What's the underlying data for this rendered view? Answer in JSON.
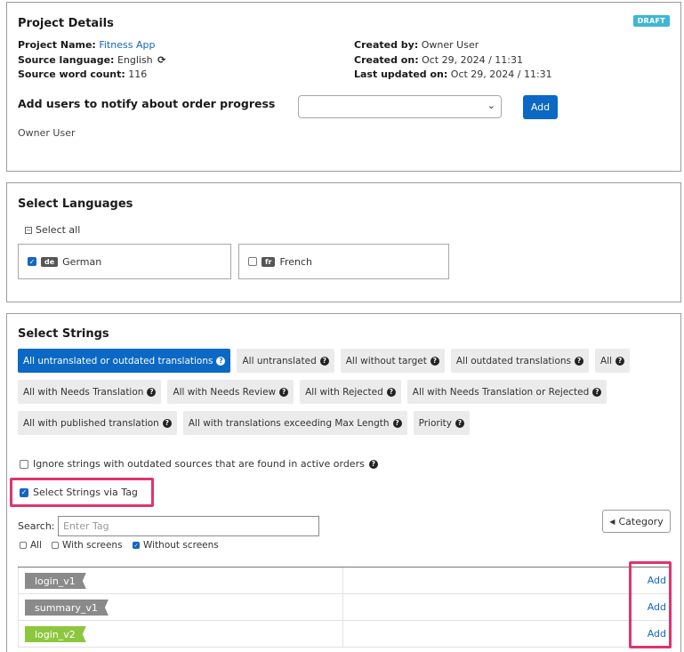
{
  "project": {
    "title": "Project Details",
    "badge": "DRAFT",
    "name_label": "Project Name:",
    "name_value": "Fitness App",
    "source_lang_label": "Source language:",
    "source_lang_value": "English",
    "word_count_label": "Source word count:",
    "word_count_value": "116",
    "created_by_label": "Created by:",
    "created_by_value": "Owner User",
    "created_on_label": "Created on:",
    "created_on_value": "Oct 29, 2024 / 11:31",
    "updated_label": "Last updated on:",
    "updated_value": "Oct 29, 2024 / 11:31",
    "notify_title": "Add users to notify about order progress",
    "add_label": "Add",
    "owner_user": "Owner User"
  },
  "languages": {
    "title": "Select Languages",
    "select_all": "Select all",
    "items": [
      {
        "code": "de",
        "name": "German",
        "checked": true
      },
      {
        "code": "fr",
        "name": "French",
        "checked": false
      }
    ]
  },
  "strings": {
    "title": "Select Strings",
    "filters": [
      {
        "label": "All untranslated or outdated translations",
        "active": true
      },
      {
        "label": "All untranslated",
        "active": false
      },
      {
        "label": "All without target",
        "active": false
      },
      {
        "label": "All outdated translations",
        "active": false
      },
      {
        "label": "All",
        "active": false
      },
      {
        "label": "All with Needs Translation",
        "active": false
      },
      {
        "label": "All with Needs Review",
        "active": false
      },
      {
        "label": "All with Rejected",
        "active": false
      },
      {
        "label": "All with Needs Translation or Rejected",
        "active": false
      },
      {
        "label": "All with published translation",
        "active": false
      },
      {
        "label": "All with translations exceeding Max Length",
        "active": false
      },
      {
        "label": "Priority",
        "active": false
      }
    ],
    "ignore_label": "Ignore strings with outdated sources that are found in active orders",
    "via_tag_label": "Select Strings via Tag",
    "search_label": "Search:",
    "search_placeholder": "Enter Tag",
    "category_label": "Category",
    "screen_all": "All",
    "screen_with": "With screens",
    "screen_without": "Without screens",
    "tags": [
      {
        "name": "login_v1",
        "color": "#8a8a8a",
        "add": "Add"
      },
      {
        "name": "summary_v1",
        "color": "#8a8a8a",
        "add": "Add"
      },
      {
        "name": "login_v2",
        "color": "#8dc63f",
        "add": "Add"
      }
    ]
  },
  "colors": {
    "primary": "#0b68c5",
    "badge": "#3fb6d4",
    "highlight": "#e0336f"
  }
}
